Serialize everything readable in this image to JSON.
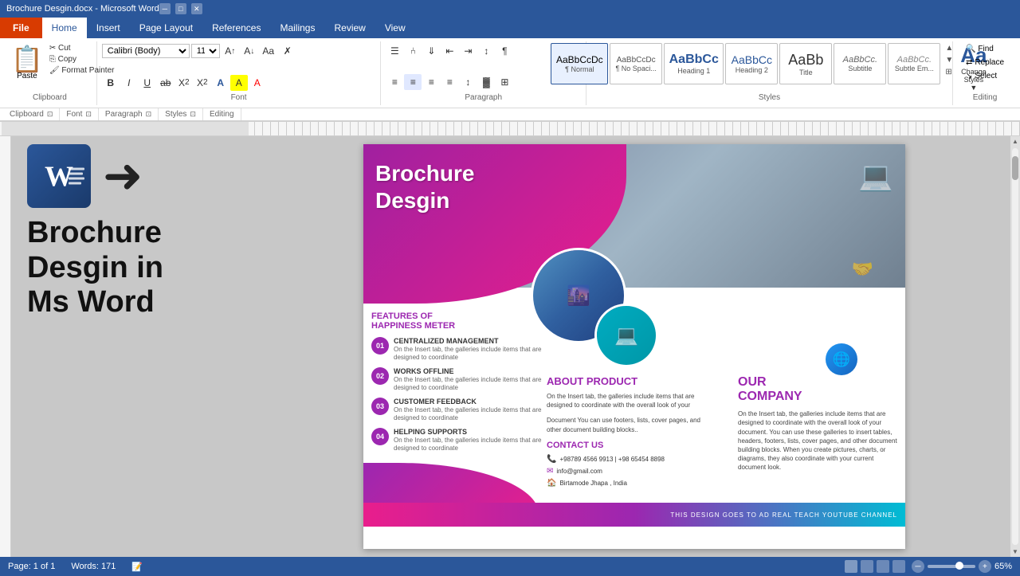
{
  "titlebar": {
    "title": "Brochure Desgin.docx - Microsoft Word",
    "controls": [
      "─",
      "□",
      "✕"
    ]
  },
  "tabs": {
    "file": "File",
    "items": [
      "Home",
      "Insert",
      "Page Layout",
      "References",
      "Mailings",
      "Review",
      "View"
    ]
  },
  "clipboard": {
    "paste": "Paste",
    "cut": "Cut",
    "copy": "Copy",
    "formatPainter": "Format Painter",
    "label": "Clipboard"
  },
  "font": {
    "name": "Calibri (Body)",
    "size": "11",
    "label": "Font",
    "buttons": [
      "B",
      "I",
      "U",
      "ab",
      "X₂",
      "X²",
      "A",
      "A"
    ],
    "growBtn": "A↑",
    "shrinkBtn": "A↓"
  },
  "paragraph": {
    "label": "Paragraph",
    "alignButtons": [
      "≡",
      "≡",
      "≡",
      "≡"
    ],
    "listButtons": [
      "☰",
      "⑃",
      "⇓"
    ]
  },
  "styles": {
    "label": "Styles",
    "scrollLabel": "▼",
    "items": [
      {
        "name": "Normal",
        "sub": "¶ Normal",
        "active": true
      },
      {
        "name": "No Spaci...",
        "sub": "¶ No Spaci..."
      },
      {
        "name": "Heading 1",
        "style": "h1"
      },
      {
        "name": "Heading 2",
        "style": "h2"
      },
      {
        "name": "Title",
        "style": "title"
      },
      {
        "name": "Subtitle",
        "style": "subtitle"
      },
      {
        "name": "Subtle Em...",
        "style": "subtle"
      }
    ],
    "changeStyles": "Change\nStyles",
    "expandBtn": "▼"
  },
  "editing": {
    "label": "Editing",
    "find": "Find",
    "replace": "Replace",
    "select": "Select"
  },
  "leftPanel": {
    "bigText": "Brochure\nDesgin in\nMs Word",
    "arrowSymbol": "➜"
  },
  "brochure": {
    "title": "Brochure\nDesgin",
    "headerTitle": "FEATURES OF\nHAPPINESS METER",
    "features": [
      {
        "num": "01",
        "title": "CENTRALIZED MANAGEMENT",
        "desc": "On the Insert tab, the galleries include items that are designed to coordinate"
      },
      {
        "num": "02",
        "title": "WORKS OFFLINE",
        "desc": "On the Insert tab, the galleries include items that are designed to coordinate"
      },
      {
        "num": "03",
        "title": "CUSTOMER FEEDBACK",
        "desc": "On the Insert tab, the galleries include items that are designed to coordinate"
      },
      {
        "num": "04",
        "title": "HELPING SUPPORTS",
        "desc": "On the Insert tab, the galleries include items that are designed to coordinate"
      }
    ],
    "aboutTitle": "ABOUT PRODUCT",
    "aboutText": "On the Insert tab, the galleries include items that are designed to coordinate with the overall look of your",
    "aboutText2": "Document You can use footers, lists, cover pages, and other document building blocks..",
    "contactTitle": "CONTACT US",
    "contactPhone": "+98789 4566 9913 | +98 65454 8898",
    "contactEmail": "info@gmail.com",
    "contactAddress": "Birtamode Jhapa , India",
    "companyTitle": "OUR\nCOMPANY",
    "companyText": "On the Insert tab, the galleries include items that are designed to coordinate with the overall look of your document. You can use these galleries to insert tables, headers, footers, lists, cover pages, and other document building blocks. When you create pictures, charts, or diagrams, they also coordinate with your current document look.",
    "bottomText": "THIS DESIGN GOES TO AD REAL TEACH YOUTUBE CHANNEL"
  },
  "statusBar": {
    "page": "Page: 1 of 1",
    "words": "Words: 171",
    "zoom": "65%",
    "zoomMinus": "─",
    "zoomPlus": "+"
  }
}
